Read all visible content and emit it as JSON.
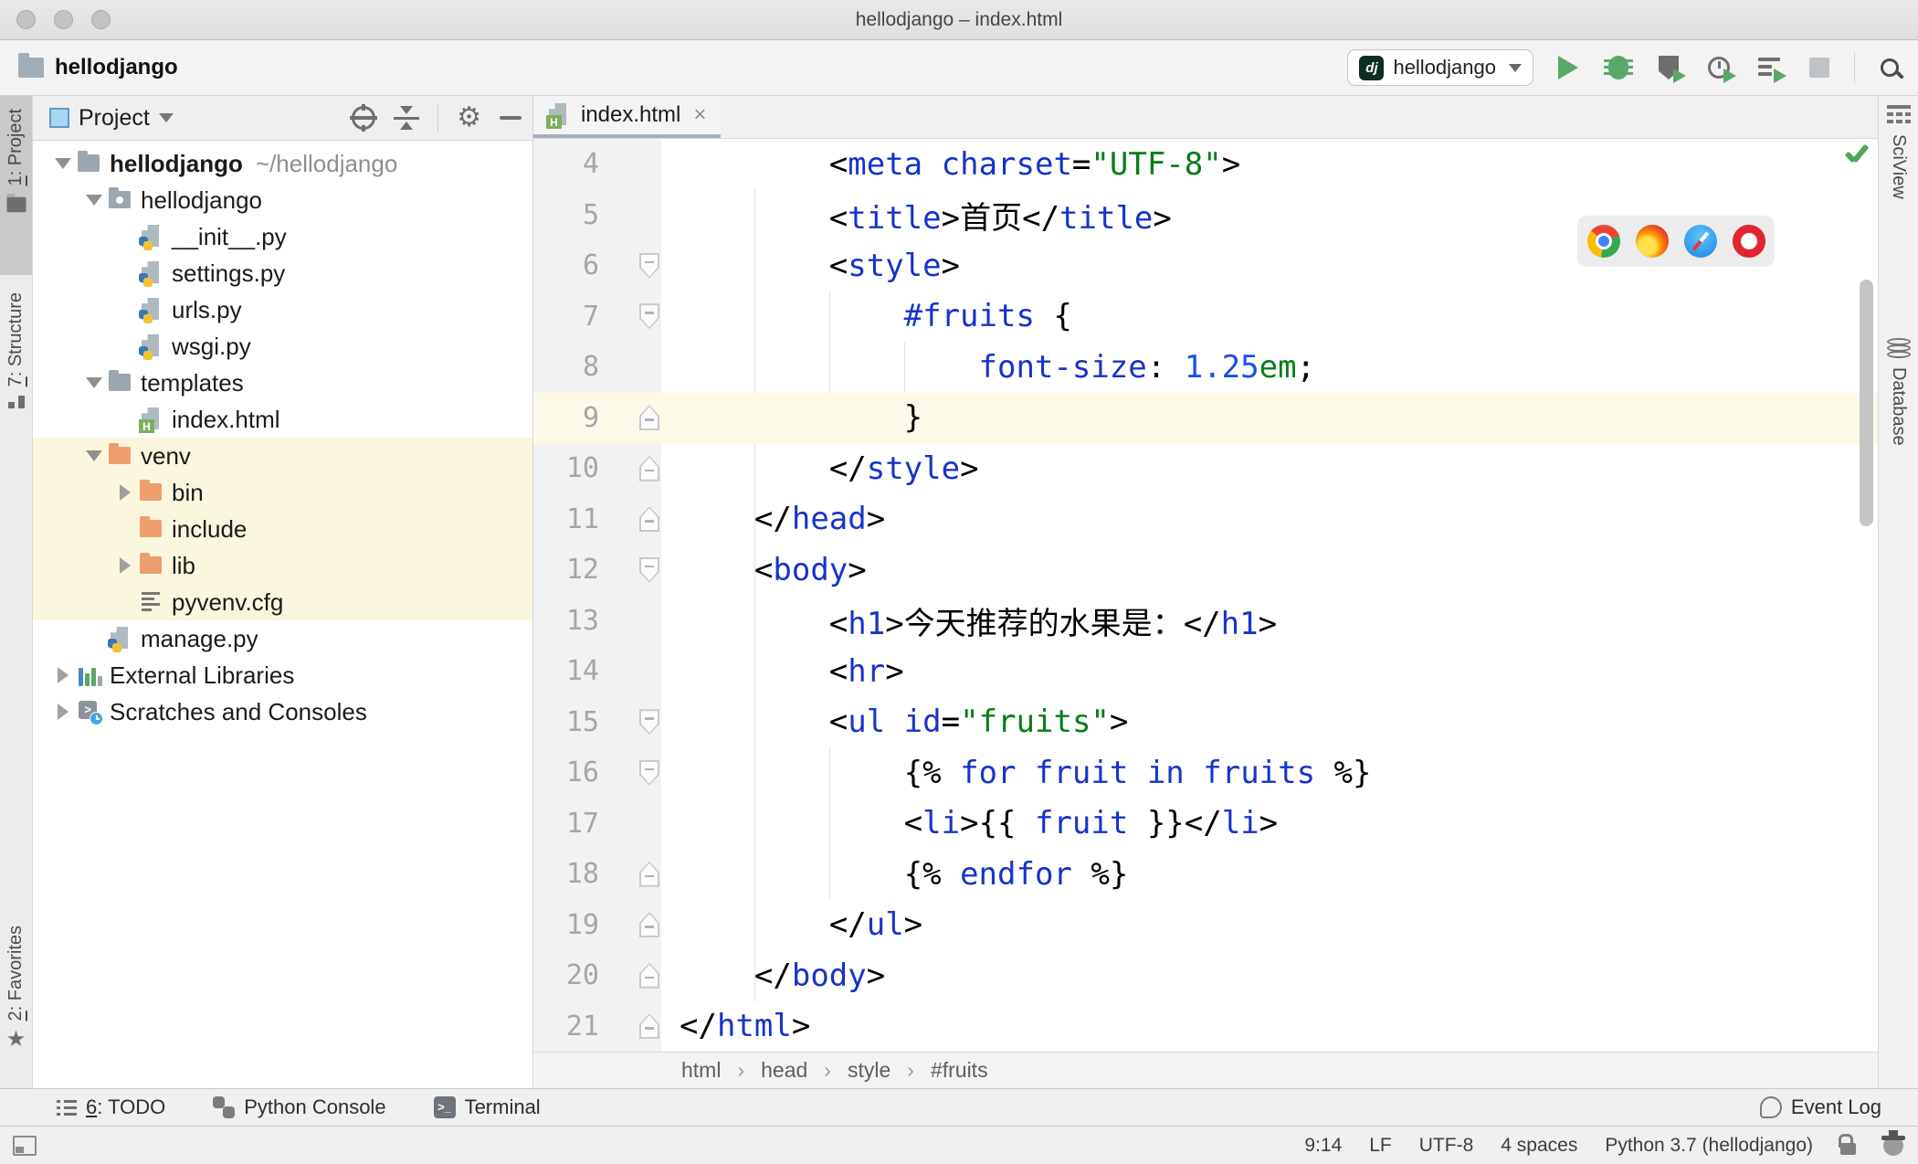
{
  "window": {
    "title": "hellodjango – index.html"
  },
  "toolbar": {
    "project_breadcrumb": "hellodjango",
    "run_config": {
      "label": "hellodjango",
      "icon": "dj"
    },
    "actions": [
      "run",
      "debug",
      "run-coverage",
      "profile",
      "run-with",
      "stop",
      "search-everywhere"
    ]
  },
  "left_stripe": {
    "items": [
      {
        "mn": "1",
        "rest": ": Project",
        "icon": "folder-icon",
        "active": true
      },
      {
        "mn": "7",
        "rest": ": Structure",
        "icon": "structure-icon",
        "active": false
      },
      {
        "mn": "2",
        "rest": ": Favorites",
        "icon": "star-icon",
        "active": false
      }
    ]
  },
  "right_stripe": {
    "items": [
      {
        "label": "SciView",
        "icon": "grid-icon"
      },
      {
        "label": "Database",
        "icon": "database-icon"
      }
    ]
  },
  "project_panel": {
    "title": "Project",
    "header_icons": [
      "locate-icon",
      "collapse-all-icon",
      "settings-gear-icon",
      "hide-icon"
    ],
    "tree": [
      {
        "i": 0,
        "arrow": "v",
        "icon": "folder",
        "label": "hellodjango",
        "bold": true,
        "sub": "~/hellodjango",
        "hl": false
      },
      {
        "i": 1,
        "arrow": "v",
        "icon": "package",
        "label": "hellodjango",
        "hl": false
      },
      {
        "i": 2,
        "arrow": "",
        "icon": "pyfile",
        "label": "__init__.py",
        "hl": false
      },
      {
        "i": 2,
        "arrow": "",
        "icon": "pyfile",
        "label": "settings.py",
        "hl": false
      },
      {
        "i": 2,
        "arrow": "",
        "icon": "pyfile",
        "label": "urls.py",
        "hl": false
      },
      {
        "i": 2,
        "arrow": "",
        "icon": "pyfile",
        "label": "wsgi.py",
        "hl": false
      },
      {
        "i": 1,
        "arrow": "v",
        "icon": "folder",
        "label": "templates",
        "hl": false
      },
      {
        "i": 2,
        "arrow": "",
        "icon": "htmlfile",
        "label": "index.html",
        "hl": false
      },
      {
        "i": 1,
        "arrow": "v",
        "icon": "folder-orange",
        "label": "venv",
        "hl": true
      },
      {
        "i": 2,
        "arrow": "r",
        "icon": "folder-orange",
        "label": "bin",
        "hl": true
      },
      {
        "i": 2,
        "arrow": "",
        "icon": "folder-orange",
        "label": "include",
        "hl": true
      },
      {
        "i": 2,
        "arrow": "r",
        "icon": "folder-orange",
        "label": "lib",
        "hl": true
      },
      {
        "i": 2,
        "arrow": "",
        "icon": "cfgfile",
        "label": "pyvenv.cfg",
        "hl": true
      },
      {
        "i": 1,
        "arrow": "",
        "icon": "pyfile",
        "label": "manage.py",
        "hl": false
      },
      {
        "i": 0,
        "arrow": "r",
        "icon": "extlib",
        "label": "External Libraries",
        "hl": false
      },
      {
        "i": 0,
        "arrow": "r",
        "icon": "scratch",
        "label": "Scratches and Consoles",
        "hl": false
      }
    ]
  },
  "editor": {
    "tab": {
      "label": "index.html",
      "close": "×"
    },
    "breadcrumbs": [
      "html",
      "head",
      "style",
      "#fruits"
    ],
    "breadcrumb_sep": "›",
    "lines": [
      {
        "n": 4,
        "fold": "",
        "cur": false,
        "tok": [
          [
            "w",
            "        "
          ],
          [
            "p",
            "<"
          ],
          [
            "t",
            "meta"
          ],
          [
            "w",
            " "
          ],
          [
            "a",
            "charset"
          ],
          [
            "p",
            "="
          ],
          [
            "s",
            "\"UTF-8\""
          ],
          [
            "p",
            ">"
          ]
        ]
      },
      {
        "n": 5,
        "fold": "",
        "cur": false,
        "tok": [
          [
            "w",
            "        "
          ],
          [
            "p",
            "<"
          ],
          [
            "t",
            "title"
          ],
          [
            "p",
            ">"
          ],
          [
            "p",
            "首页"
          ],
          [
            "p",
            "</"
          ],
          [
            "t",
            "title"
          ],
          [
            "p",
            ">"
          ]
        ]
      },
      {
        "n": 6,
        "fold": "d",
        "cur": false,
        "tok": [
          [
            "w",
            "        "
          ],
          [
            "p",
            "<"
          ],
          [
            "t",
            "style"
          ],
          [
            "p",
            ">"
          ]
        ]
      },
      {
        "n": 7,
        "fold": "d",
        "cur": false,
        "tok": [
          [
            "w",
            "            "
          ],
          [
            "v",
            "#fruits"
          ],
          [
            "p",
            " {"
          ]
        ]
      },
      {
        "n": 8,
        "fold": "",
        "cur": false,
        "tok": [
          [
            "w",
            "                "
          ],
          [
            "a",
            "font-size"
          ],
          [
            "p",
            ": "
          ],
          [
            "n",
            "1.25"
          ],
          [
            "u",
            "em"
          ],
          [
            "p",
            ";"
          ]
        ]
      },
      {
        "n": 9,
        "fold": "u",
        "cur": true,
        "tok": [
          [
            "w",
            "            "
          ],
          [
            "p",
            "}"
          ]
        ]
      },
      {
        "n": 10,
        "fold": "u",
        "cur": false,
        "tok": [
          [
            "w",
            "        "
          ],
          [
            "p",
            "</"
          ],
          [
            "t",
            "style"
          ],
          [
            "p",
            ">"
          ]
        ]
      },
      {
        "n": 11,
        "fold": "u",
        "cur": false,
        "tok": [
          [
            "w",
            "    "
          ],
          [
            "p",
            "</"
          ],
          [
            "t",
            "head"
          ],
          [
            "p",
            ">"
          ]
        ]
      },
      {
        "n": 12,
        "fold": "d",
        "cur": false,
        "tok": [
          [
            "w",
            "    "
          ],
          [
            "p",
            "<"
          ],
          [
            "t",
            "body"
          ],
          [
            "p",
            ">"
          ]
        ]
      },
      {
        "n": 13,
        "fold": "",
        "cur": false,
        "tok": [
          [
            "w",
            "        "
          ],
          [
            "p",
            "<"
          ],
          [
            "t",
            "h1"
          ],
          [
            "p",
            ">"
          ],
          [
            "p",
            "今天推荐的水果是："
          ],
          [
            "p",
            "</"
          ],
          [
            "t",
            "h1"
          ],
          [
            "p",
            ">"
          ]
        ]
      },
      {
        "n": 14,
        "fold": "",
        "cur": false,
        "tok": [
          [
            "w",
            "        "
          ],
          [
            "p",
            "<"
          ],
          [
            "t",
            "hr"
          ],
          [
            "p",
            ">"
          ]
        ]
      },
      {
        "n": 15,
        "fold": "d",
        "cur": false,
        "tok": [
          [
            "w",
            "        "
          ],
          [
            "p",
            "<"
          ],
          [
            "t",
            "ul"
          ],
          [
            "w",
            " "
          ],
          [
            "a",
            "id"
          ],
          [
            "p",
            "="
          ],
          [
            "s",
            "\"fruits\""
          ],
          [
            "p",
            ">"
          ]
        ]
      },
      {
        "n": 16,
        "fold": "d",
        "cur": false,
        "tok": [
          [
            "w",
            "            "
          ],
          [
            "p",
            "{% "
          ],
          [
            "k",
            "for"
          ],
          [
            "w",
            " "
          ],
          [
            "v",
            "fruit"
          ],
          [
            "w",
            " "
          ],
          [
            "k",
            "in"
          ],
          [
            "w",
            " "
          ],
          [
            "v",
            "fruits"
          ],
          [
            "p",
            " %}"
          ]
        ]
      },
      {
        "n": 17,
        "fold": "",
        "cur": false,
        "tok": [
          [
            "w",
            "            "
          ],
          [
            "p",
            "<"
          ],
          [
            "t",
            "li"
          ],
          [
            "p",
            ">"
          ],
          [
            "p",
            "{{ "
          ],
          [
            "v",
            "fruit"
          ],
          [
            "p",
            " }}"
          ],
          [
            "p",
            "</"
          ],
          [
            "t",
            "li"
          ],
          [
            "p",
            ">"
          ]
        ]
      },
      {
        "n": 18,
        "fold": "u",
        "cur": false,
        "tok": [
          [
            "w",
            "            "
          ],
          [
            "p",
            "{% "
          ],
          [
            "k",
            "endfor"
          ],
          [
            "p",
            " %}"
          ]
        ]
      },
      {
        "n": 19,
        "fold": "u",
        "cur": false,
        "tok": [
          [
            "w",
            "        "
          ],
          [
            "p",
            "</"
          ],
          [
            "t",
            "ul"
          ],
          [
            "p",
            ">"
          ]
        ]
      },
      {
        "n": 20,
        "fold": "u",
        "cur": false,
        "tok": [
          [
            "w",
            "    "
          ],
          [
            "p",
            "</"
          ],
          [
            "t",
            "body"
          ],
          [
            "p",
            ">"
          ]
        ]
      },
      {
        "n": 21,
        "fold": "u",
        "cur": false,
        "tok": [
          [
            "p",
            "</"
          ],
          [
            "t",
            "html"
          ],
          [
            "p",
            ">"
          ]
        ]
      }
    ],
    "browser_popup": [
      "chrome",
      "firefox",
      "safari",
      "opera"
    ],
    "inspection_status": "no-problems-check"
  },
  "toolwindow_bar": {
    "left": [
      {
        "mn": "6",
        "rest": ": TODO",
        "icon": "todo-list-icon"
      },
      {
        "mn": "",
        "rest": "Python Console",
        "icon": "python-icon"
      },
      {
        "mn": "",
        "rest": "Terminal",
        "icon": "terminal-icon"
      }
    ],
    "event_log": "Event Log"
  },
  "statusbar": {
    "items": [
      "9:14",
      "LF",
      "UTF-8",
      "4 spaces",
      "Python 3.7 (hellodjango)"
    ],
    "icons": [
      "unlock-icon",
      "inspections-profile-icon"
    ]
  },
  "colors": {
    "tag_blue": "#1733C9",
    "string_green": "#067D17",
    "number_blue": "#1750EB",
    "current_line": "#FCF9E8",
    "tree_highlight": "#FAF7DE",
    "run_green": "#59A869",
    "tab_underline": "#A4AFBD",
    "django_icon_bg": "#0A2E21"
  }
}
